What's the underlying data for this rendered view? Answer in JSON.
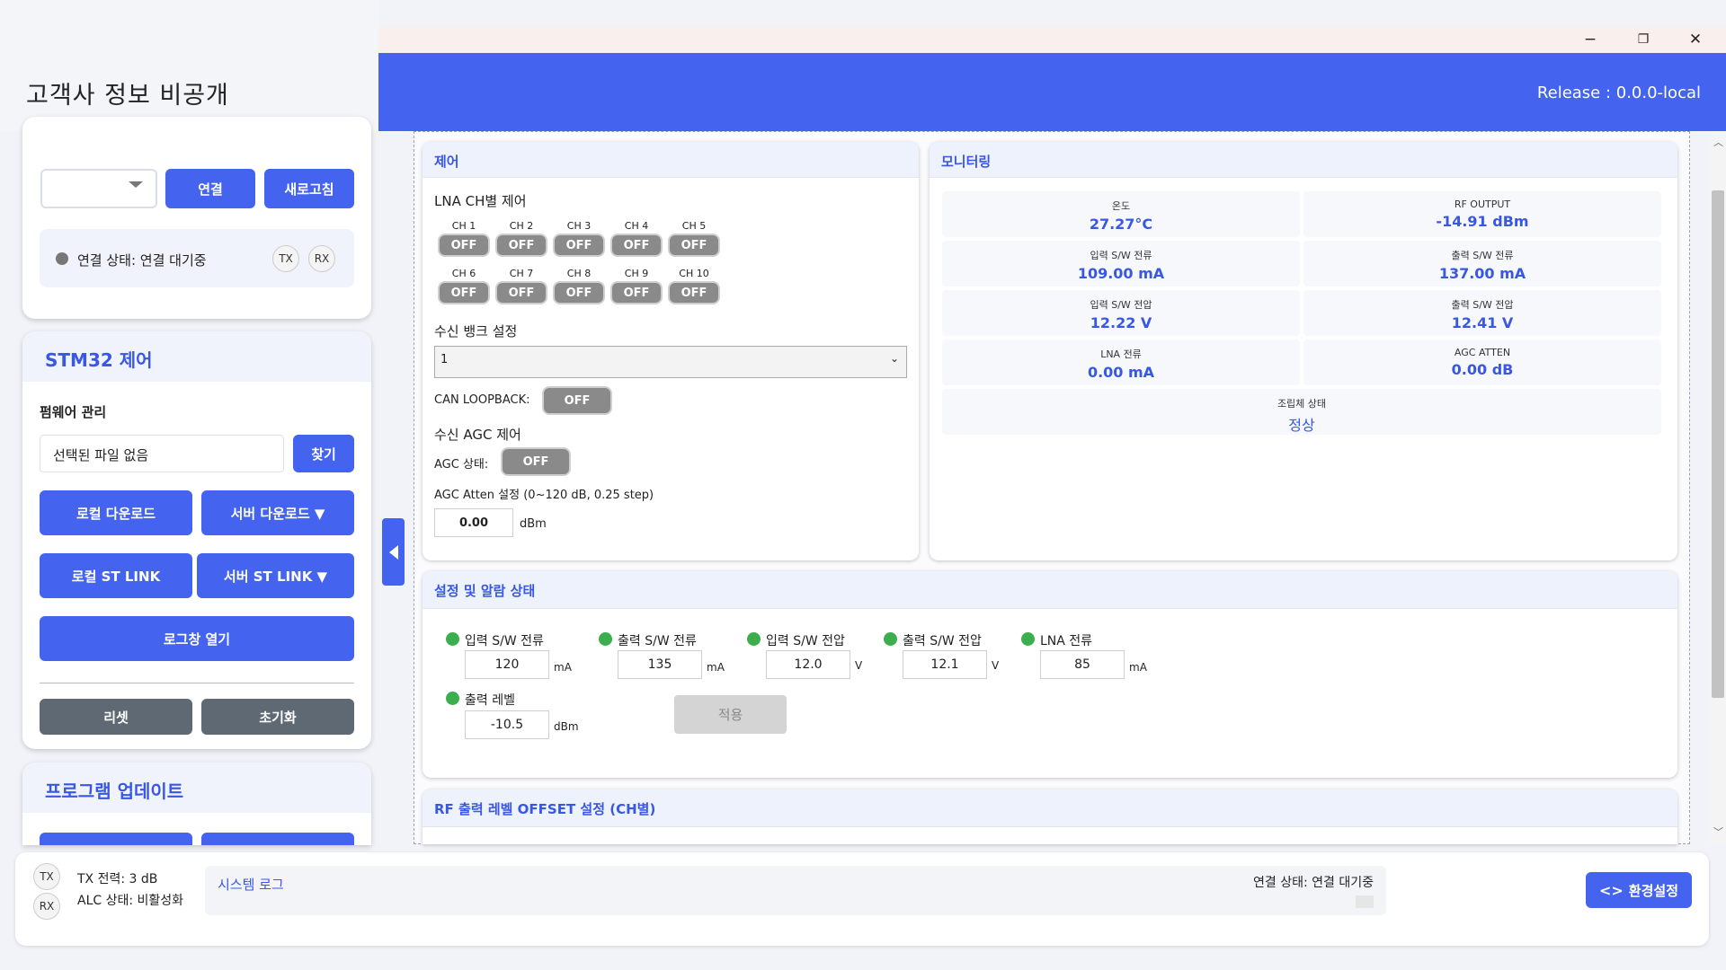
{
  "app": {
    "title": "고객사 정보 비공개",
    "release": "Release : 0.0.0-local"
  },
  "window_controls": {
    "minimize": "−",
    "maximize": "❐",
    "close": "✕"
  },
  "sidebar": {
    "connection": {
      "port_select_value": "",
      "connect_label": "연결",
      "refresh_label": "새로고침",
      "status_text": "연결 상태: 연결 대기중",
      "tx": "TX",
      "rx": "RX"
    },
    "stm32": {
      "title": "STM32 제어",
      "firmware_label": "펌웨어 관리",
      "file_placeholder": "선택된 파일 없음",
      "find_label": "찾기",
      "local_download": "로컬 다운로드",
      "server_download": "서버 다운로드 ▼",
      "local_stlink": "로컬 ST LINK",
      "server_stlink": "서버 ST LINK ▼",
      "open_log": "로그창 열기",
      "reset": "리셋",
      "init": "초기화"
    },
    "update": {
      "title": "프로그램 업데이트"
    }
  },
  "control": {
    "title": "제어",
    "lna_title": "LNA CH별 제어",
    "channels": [
      {
        "name": "CH 1",
        "state": "OFF"
      },
      {
        "name": "CH 2",
        "state": "OFF"
      },
      {
        "name": "CH 3",
        "state": "OFF"
      },
      {
        "name": "CH 4",
        "state": "OFF"
      },
      {
        "name": "CH 5",
        "state": "OFF"
      },
      {
        "name": "CH 6",
        "state": "OFF"
      },
      {
        "name": "CH 7",
        "state": "OFF"
      },
      {
        "name": "CH 8",
        "state": "OFF"
      },
      {
        "name": "CH 9",
        "state": "OFF"
      },
      {
        "name": "CH 10",
        "state": "OFF"
      }
    ],
    "bank_title": "수신 뱅크 설정",
    "bank_value": "1",
    "can_loopback_label": "CAN LOOPBACK:",
    "can_loopback_state": "OFF",
    "agc_title": "수신 AGC 제어",
    "agc_state_label": "AGC 상태:",
    "agc_state": "OFF",
    "agc_atten_label": "AGC Atten 설정 (0~120 dB, 0.25 step)",
    "agc_atten_value": "0.00",
    "agc_atten_unit": "dBm"
  },
  "monitoring": {
    "title": "모니터링",
    "cells": [
      {
        "key": "온도",
        "value": "27.27°C"
      },
      {
        "key": "RF OUTPUT",
        "value": "-14.91 dBm"
      },
      {
        "key": "입력 S/W 전류",
        "value": "109.00 mA"
      },
      {
        "key": "출력 S/W 전류",
        "value": "137.00 mA"
      },
      {
        "key": "입력 S/W 전압",
        "value": "12.22 V"
      },
      {
        "key": "출력 S/W 전압",
        "value": "12.41 V"
      },
      {
        "key": "LNA 전류",
        "value": "0.00 mA"
      },
      {
        "key": "AGC ATTEN",
        "value": "0.00 dB"
      }
    ],
    "assembly_key": "조립체 상태",
    "assembly_value": "정상"
  },
  "alarm": {
    "title": "설정 및 알람 상태",
    "items": [
      {
        "label": "입력 S/W 전류",
        "value": "120",
        "unit": "mA"
      },
      {
        "label": "출력 S/W 전류",
        "value": "135",
        "unit": "mA"
      },
      {
        "label": "입력 S/W 전압",
        "value": "12.0",
        "unit": "V"
      },
      {
        "label": "출력 S/W 전압",
        "value": "12.1",
        "unit": "V"
      },
      {
        "label": "LNA 전류",
        "value": "85",
        "unit": "mA"
      },
      {
        "label": "출력 레벨",
        "value": "-10.5",
        "unit": "dBm"
      }
    ],
    "apply_label": "적용"
  },
  "offset": {
    "title": "RF 출력 레벨 OFFSET 설정 (CH별)"
  },
  "bottom": {
    "tx": "TX",
    "rx": "RX",
    "tx_power": "TX 전력: 3 dB",
    "alc_state": "ALC 상태: 비활성화",
    "log_title": "시스템 로그",
    "conn_status": "연결 상태: 연결 대기중",
    "settings_label": "환경설정"
  },
  "colors": {
    "accent": "#4463ef",
    "status_ok": "#3cae4e",
    "toggle_off": "#8a8a8a"
  }
}
